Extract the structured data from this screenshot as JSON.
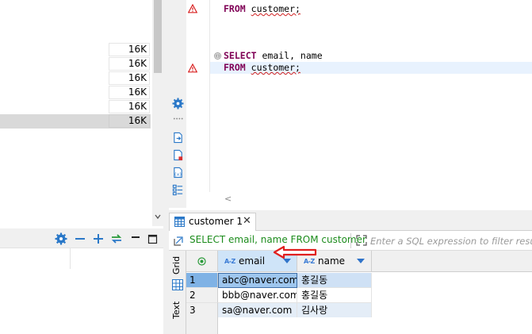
{
  "navigator": {
    "sizes": [
      "16K",
      "16K",
      "16K",
      "16K",
      "16K",
      "16K"
    ],
    "selected_index": 5
  },
  "navigator_toolbar": {
    "icons": [
      "gear-icon",
      "collapse-icon",
      "expand-icon",
      "link-icon",
      "minimize-icon",
      "maximize-icon"
    ]
  },
  "editor": {
    "lines": {
      "line1_from": "FROM",
      "line1_table": "customer;",
      "line2_select": "SELECT",
      "line2_cols": " email, name",
      "line3_from": "FROM",
      "line3_table": "customer;"
    },
    "side_icons": [
      "gear-icon",
      "more-icon",
      "execute-script-icon",
      "export-icon",
      "variables-icon",
      "outline-icon"
    ],
    "fold_symbol": "⊖",
    "scroll_left_symbol": "<"
  },
  "results": {
    "tab_label": "customer 1",
    "tab_close": "✕",
    "filter_query": "SELECT email, name FROM customer",
    "filter_placeholder": "Enter a SQL expression to filter results (use Ctrl+Space)",
    "view_tabs": {
      "grid": "Grid",
      "text": "Text"
    },
    "columns": [
      {
        "name": "email",
        "type_icon": "A-Z"
      },
      {
        "name": "name",
        "type_icon": "A-Z"
      }
    ],
    "rows": [
      {
        "num": "1",
        "email": "abc@naver.com",
        "name": "홍길동"
      },
      {
        "num": "2",
        "email": "bbb@naver.com",
        "name": "홍길동"
      },
      {
        "num": "3",
        "email": "sa@naver.com",
        "name": "김사랑"
      }
    ]
  },
  "colors": {
    "keyword": "#7f0055",
    "filter_text": "#1c8c1c",
    "selection": "#cfe1f5",
    "accent_arrow": "#e02020"
  }
}
